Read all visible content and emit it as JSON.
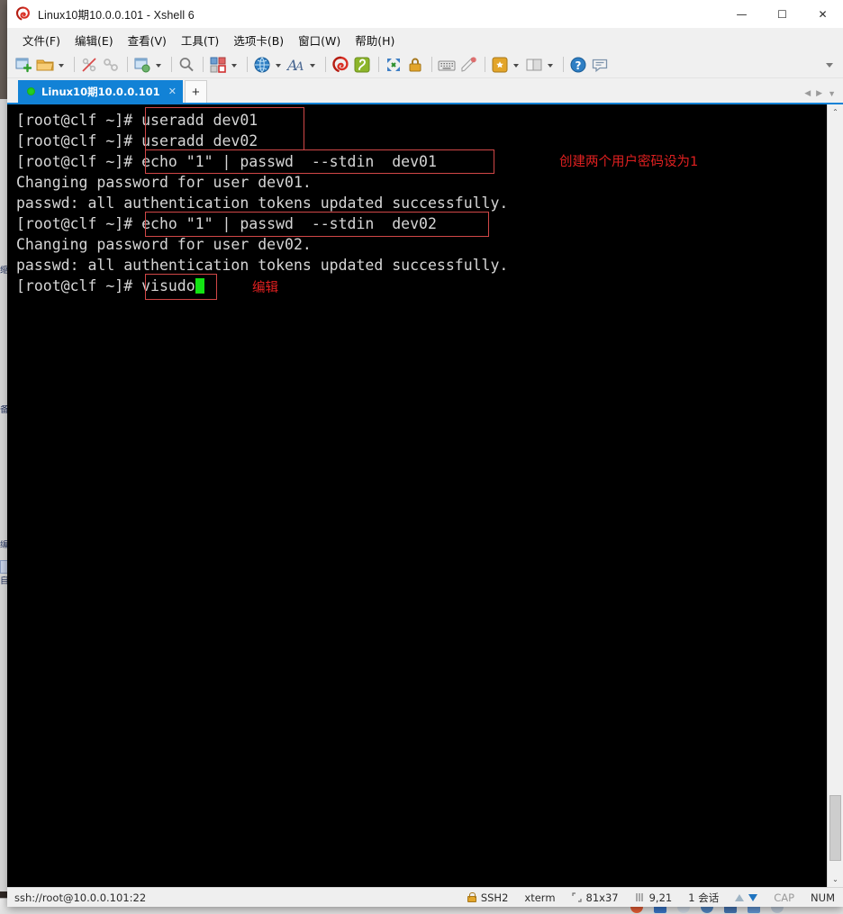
{
  "window": {
    "title": "Linux10期10.0.0.101 - Xshell 6",
    "app_logo_icon": "xshell-logo-icon",
    "controls": {
      "minimize": "—",
      "maximize": "☐",
      "close": "✕"
    }
  },
  "menubar": {
    "items": [
      {
        "label": "文件(F)",
        "name": "menu-file"
      },
      {
        "label": "编辑(E)",
        "name": "menu-edit"
      },
      {
        "label": "查看(V)",
        "name": "menu-view"
      },
      {
        "label": "工具(T)",
        "name": "menu-tools"
      },
      {
        "label": "选项卡(B)",
        "name": "menu-tab"
      },
      {
        "label": "窗口(W)",
        "name": "menu-window"
      },
      {
        "label": "帮助(H)",
        "name": "menu-help"
      }
    ]
  },
  "toolbar": {
    "icons": [
      "new-session-icon",
      "open-folder-icon",
      "caret-open-folder",
      "separator",
      "disconnect-icon",
      "connect-icon",
      "separator",
      "properties-icon",
      "caret-properties",
      "separator",
      "find-icon",
      "separator",
      "transfer-icon",
      "caret-transfer",
      "separator",
      "globe-icon",
      "caret-globe",
      "font-icon",
      "caret-font",
      "separator",
      "xshell-icon",
      "xftp-icon",
      "separator",
      "fullscreen-icon",
      "lock-icon",
      "separator",
      "keyboard-icon",
      "highlight-icon",
      "separator",
      "script-icon",
      "caret-script",
      "layout-icon",
      "caret-layout",
      "separator",
      "help-icon",
      "chat-icon"
    ],
    "overflow_icon": "toolbar-overflow-icon"
  },
  "tabs": {
    "active": {
      "label": "Linux10期10.0.0.101",
      "status_icon": "connected-dot-icon",
      "close_icon": "tab-close-icon"
    },
    "new_tab_icon": "new-tab-plus-icon",
    "nav_prev_icon": "tab-nav-prev-icon",
    "nav_next_icon": "tab-nav-next-icon",
    "nav_menu_icon": "tab-nav-menu-icon"
  },
  "terminal": {
    "background_color": "#000000",
    "foreground_color": "#d6d6d6",
    "cursor_color": "#13e313",
    "annotation_color": "#e02020",
    "lines": [
      "[root@clf ~]# useradd dev01",
      "[root@clf ~]# useradd dev02",
      "[root@clf ~]# echo \"1\" | passwd  --stdin  dev01",
      "Changing password for user dev01.",
      "passwd: all authentication tokens updated successfully.",
      "[root@clf ~]# echo \"1\" | passwd  --stdin  dev02",
      "Changing password for user dev02.",
      "passwd: all authentication tokens updated successfully.",
      "[root@clf ~]# visudo"
    ],
    "annotations": [
      {
        "text": "创建两个用户密码设为1",
        "name": "annotation-create-users"
      },
      {
        "text": "编辑",
        "name": "annotation-edit"
      }
    ],
    "scrollbar": {
      "up_arrow": "⌃",
      "down_arrow": "⌄"
    }
  },
  "statusbar": {
    "url": "ssh://root@10.0.0.101:22",
    "protocol": "SSH2",
    "terminal_type": "xterm",
    "size": "81x37",
    "cursor_position": "9,21",
    "sessions": "1 会话",
    "caps": "CAP",
    "num": "NUM",
    "lock_icon": "ssh-lock-icon",
    "size_icon": "terminal-size-icon",
    "position_icon": "cursor-position-icon",
    "upload_icon": "upload-arrow-icon",
    "download_icon": "download-arrow-icon"
  }
}
